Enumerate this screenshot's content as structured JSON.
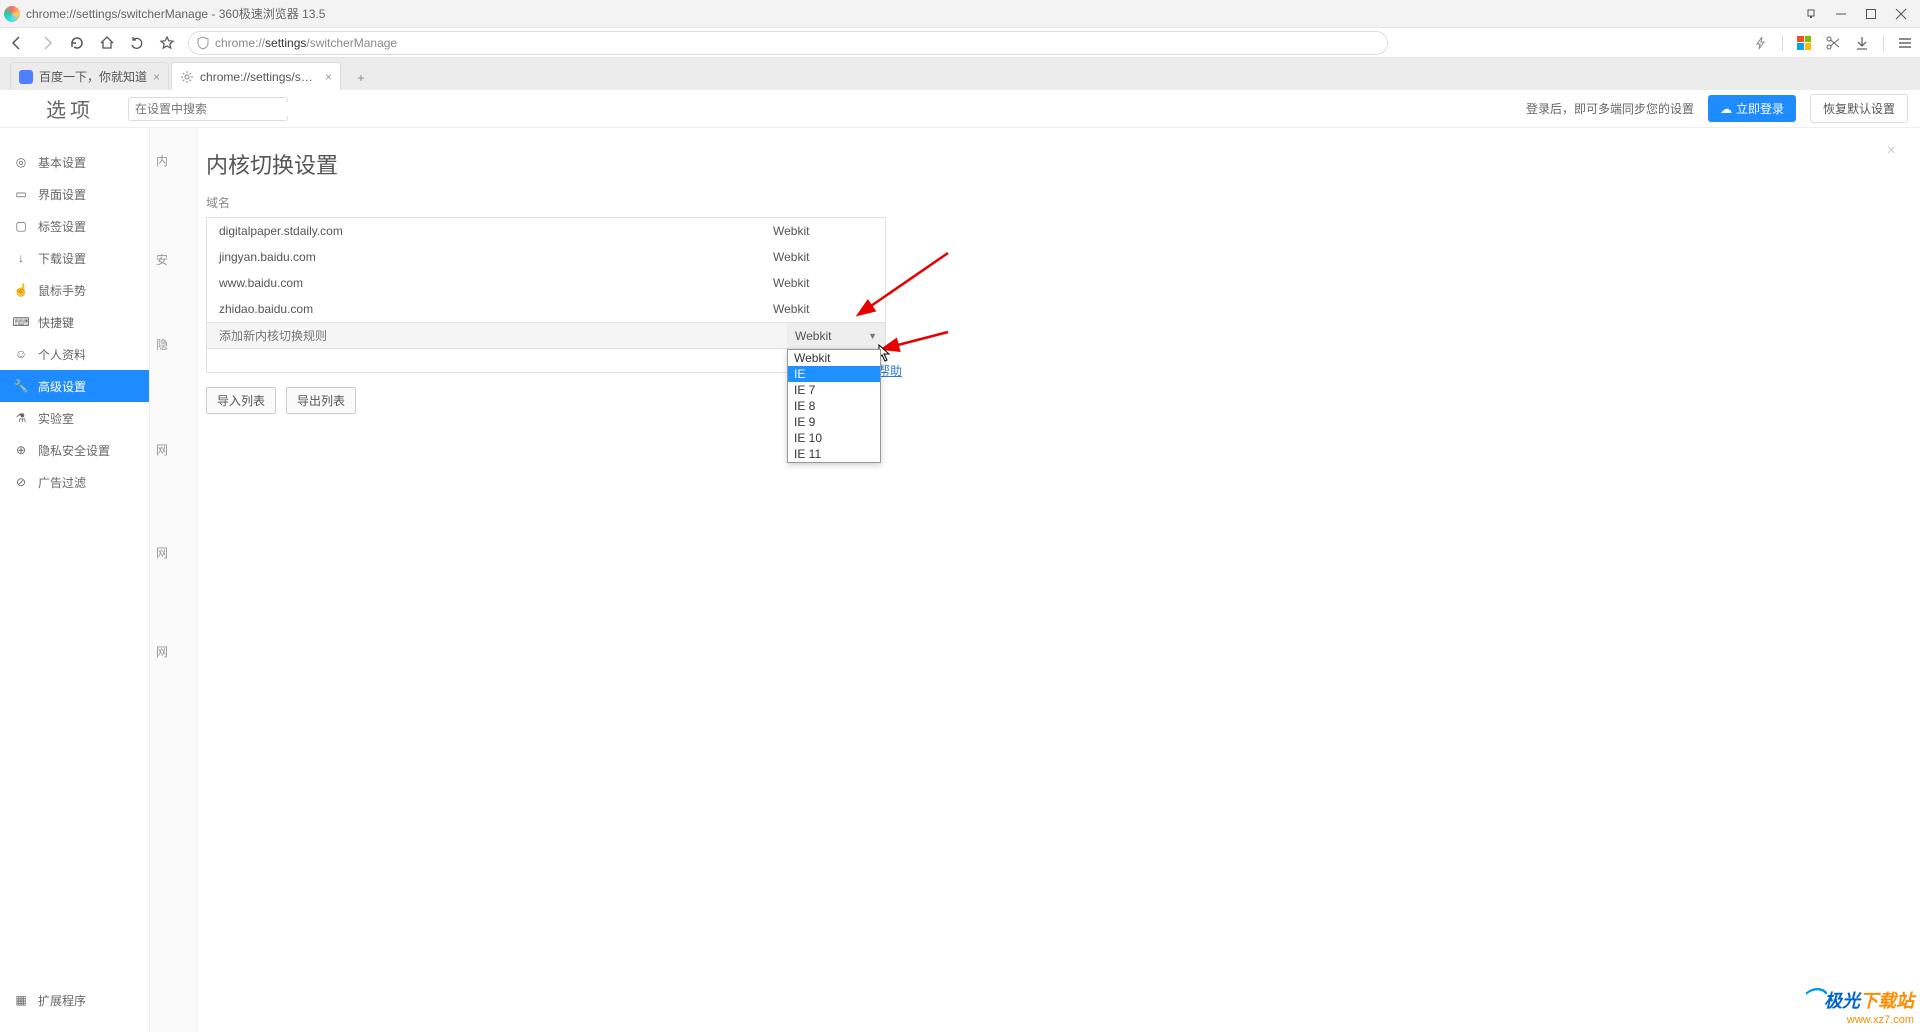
{
  "window": {
    "title": "chrome://settings/switcherManage - 360极速浏览器 13.5"
  },
  "address": {
    "url_prefix": "chrome://",
    "url_bold": "settings",
    "url_suffix": "/switcherManage"
  },
  "tabs": [
    {
      "title": "百度一下，你就知道",
      "active": false
    },
    {
      "title": "chrome://settings/switcherM",
      "active": true
    }
  ],
  "settings_header": {
    "title": "选项",
    "search_placeholder": "在设置中搜索",
    "sync_text": "登录后，即可多端同步您的设置",
    "login_button": "立即登录",
    "reset_button": "恢复默认设置"
  },
  "sidebar": {
    "items": [
      {
        "label": "基本设置"
      },
      {
        "label": "界面设置"
      },
      {
        "label": "标签设置"
      },
      {
        "label": "下载设置"
      },
      {
        "label": "鼠标手势"
      },
      {
        "label": "快捷键"
      },
      {
        "label": "个人资料"
      },
      {
        "label": "高级设置"
      },
      {
        "label": "实验室"
      },
      {
        "label": "隐私安全设置"
      },
      {
        "label": "广告过滤"
      }
    ],
    "active_index": 7,
    "ext_label": "扩展程序"
  },
  "bg_labels": [
    "内",
    "安",
    "隐",
    "网",
    "网",
    "网"
  ],
  "panel": {
    "title": "内核切换设置",
    "domain_label": "域名",
    "rules": [
      {
        "domain": "digitalpaper.stdaily.com",
        "engine": "Webkit"
      },
      {
        "domain": "jingyan.baidu.com",
        "engine": "Webkit"
      },
      {
        "domain": "www.baidu.com",
        "engine": "Webkit"
      },
      {
        "domain": "zhidao.baidu.com",
        "engine": "Webkit"
      }
    ],
    "add_placeholder": "添加新内核切换规则",
    "selected_engine": "Webkit",
    "engine_options": [
      "Webkit",
      "IE",
      "IE 7",
      "IE 8",
      "IE 9",
      "IE 10",
      "IE 11"
    ],
    "highlighted_option_index": 1,
    "import_btn": "导入列表",
    "export_btn": "导出列表",
    "help_link": "帮助"
  },
  "watermark": {
    "brand1": "极光",
    "brand2": "下载站",
    "url": "www.xz7.com"
  }
}
